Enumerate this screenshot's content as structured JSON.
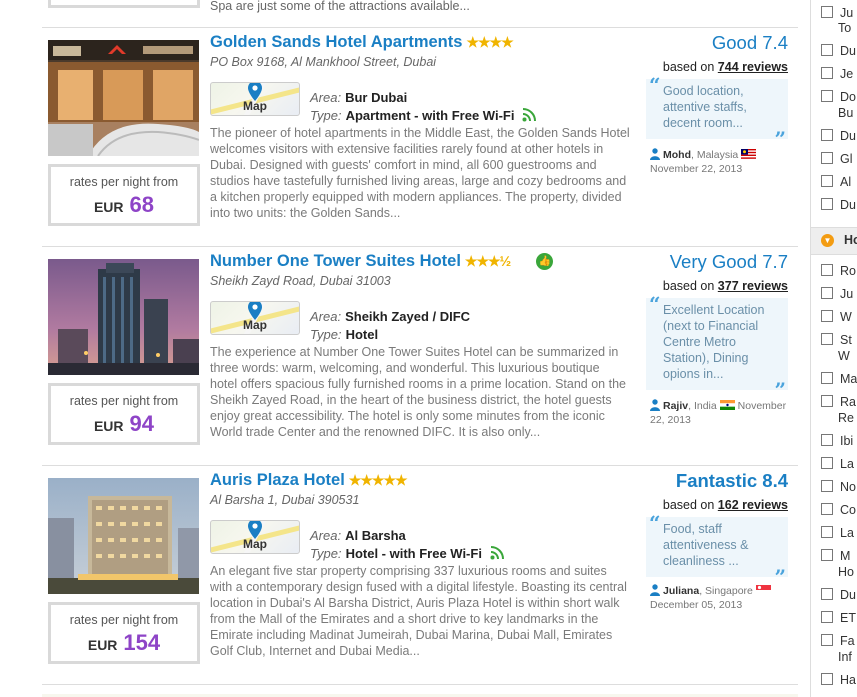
{
  "top_fragment": {
    "text": "Spa are just some of the attractions available..."
  },
  "hotels": [
    {
      "name": "Golden Sands Hotel Apartments",
      "stars": "★★★★",
      "address": "PO Box 9168, Al Mankhool Street, Dubai",
      "map_label": "Map",
      "area_label": "Area:",
      "area": "Bur Dubai",
      "type_label": "Type:",
      "type": "Apartment - with Free Wi-Fi",
      "description": "The pioneer of hotel apartments in the Middle East, the Golden Sands Hotel welcomes visitors with extensive facilities rarely found at other hotels in Dubai. Designed with guests' comfort in mind, all 600 guestrooms and studios have tastefully furnished living areas, large and cozy bedrooms and a kitchen properly equipped with modern appliances. The property, divided into two units: the Golden Sands...",
      "rate_label": "rates per night from",
      "currency": "EUR",
      "price": "68",
      "score_text": "Good 7.4",
      "based_label": "based on",
      "reviews": "744 reviews",
      "quote": "Good location, attentive staffs, decent room...",
      "reviewer": "Mohd",
      "country": ", Malaysia",
      "date": "November 22, 2013"
    },
    {
      "name": "Number One Tower Suites Hotel",
      "stars": "★★★½",
      "address": "Sheikh Zayd Road, Dubai 31003",
      "map_label": "Map",
      "area_label": "Area:",
      "area": "Sheikh Zayed / DIFC",
      "type_label": "Type:",
      "type": "Hotel",
      "description": "The experience at Number One Tower Suites Hotel can be summarized in three words: warm, welcoming, and wonderful. This luxurious boutique hotel offers spacious fully furnished rooms in a prime location. Stand on the Sheikh Zayed Road, in the heart of the business district, the hotel guests enjoy great accessibility. The hotel is only some minutes from the iconic World trade Center and the renowned DIFC. It is also only...",
      "rate_label": "rates per night from",
      "currency": "EUR",
      "price": "94",
      "score_text": "Very Good 7.7",
      "based_label": "based on",
      "reviews": "377 reviews",
      "quote": "Excellent Location (next to Financial Centre Metro Station), Dining opions in...",
      "reviewer": "Rajiv",
      "country": ", India",
      "date": "November 22, 2013"
    },
    {
      "name": "Auris Plaza Hotel",
      "stars": "★★★★★",
      "address": "Al Barsha 1, Dubai 390531",
      "map_label": "Map",
      "area_label": "Area:",
      "area": "Al Barsha",
      "type_label": "Type:",
      "type": "Hotel - with Free Wi-Fi",
      "description": "An elegant five star property comprising 337 luxurious rooms and suites with a contemporary design fused with a digital lifestyle. Boasting its central location in Dubai's Al Barsha District, Auris Plaza Hotel is within short walk from the Mall of the Emirates and a short drive to key landmarks in the Emirate including Madinat Jumeirah, Dubai Marina, Dubai Mall, Emirates Golf Club, Internet and Dubai Media...",
      "rate_label": "rates per night from",
      "currency": "EUR",
      "price": "154",
      "score_text": "Fantastic 8.4",
      "based_label": "based on",
      "reviews": "162 reviews",
      "quote": "Food, staff attentiveness & cleanliness ...",
      "reviewer": "Juliana",
      "country": ", Singapore",
      "date": "December 05, 2013"
    }
  ],
  "sidebar": {
    "top_items": [
      "Ju",
      "Du",
      "Je",
      "Do",
      "Du",
      "Gl",
      "Al",
      "Du"
    ],
    "top_item_second_lines": [
      "To",
      "Bu"
    ],
    "section_title": "Ho",
    "bottom_items": [
      "Ro",
      "Ju",
      "W",
      "St",
      "Ma",
      "Ra",
      "Ibi",
      "La",
      "No",
      "Co",
      "La",
      "M",
      "Du",
      "ET",
      "Fa",
      "Ha"
    ],
    "bottom_item_second_lines": [
      "W",
      "Re",
      "Ho",
      "Inf"
    ]
  },
  "colors": {
    "link_blue": "#1a7fc4",
    "price_purple": "#8e44c7",
    "star_gold": "#f0b400",
    "wifi_green": "#3aa63a"
  }
}
